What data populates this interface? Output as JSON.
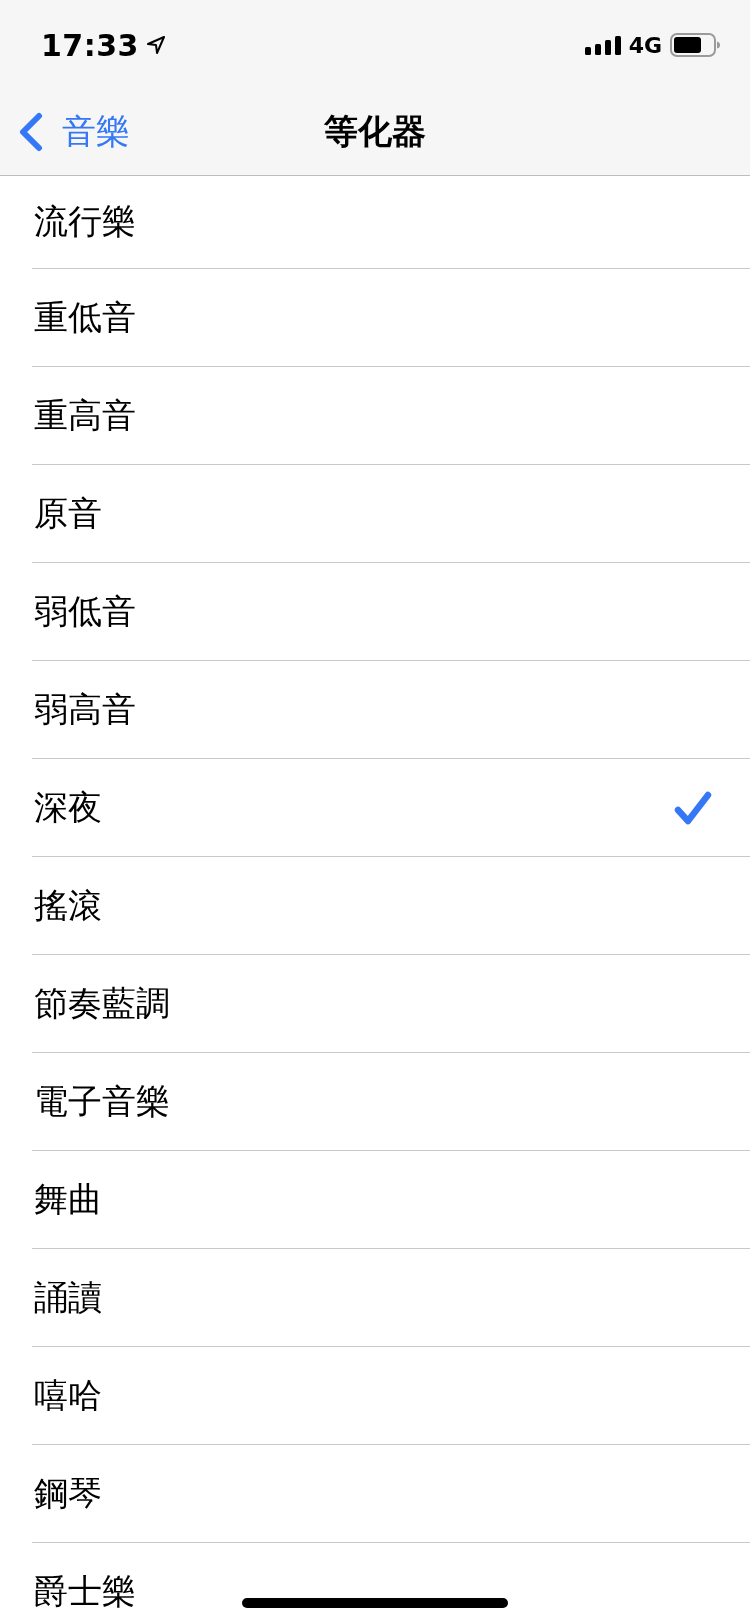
{
  "status_bar": {
    "time": "17:33",
    "network": "4G"
  },
  "nav_bar": {
    "back_label": "音樂",
    "title": "等化器"
  },
  "equalizer_presets": [
    {
      "label": "流行樂",
      "selected": false
    },
    {
      "label": "重低音",
      "selected": false
    },
    {
      "label": "重高音",
      "selected": false
    },
    {
      "label": "原音",
      "selected": false
    },
    {
      "label": "弱低音",
      "selected": false
    },
    {
      "label": "弱高音",
      "selected": false
    },
    {
      "label": "深夜",
      "selected": true
    },
    {
      "label": "搖滾",
      "selected": false
    },
    {
      "label": "節奏藍調",
      "selected": false
    },
    {
      "label": "電子音樂",
      "selected": false
    },
    {
      "label": "舞曲",
      "selected": false
    },
    {
      "label": "誦讀",
      "selected": false
    },
    {
      "label": "嘻哈",
      "selected": false
    },
    {
      "label": "鋼琴",
      "selected": false
    },
    {
      "label": "爵士樂",
      "selected": false
    }
  ]
}
